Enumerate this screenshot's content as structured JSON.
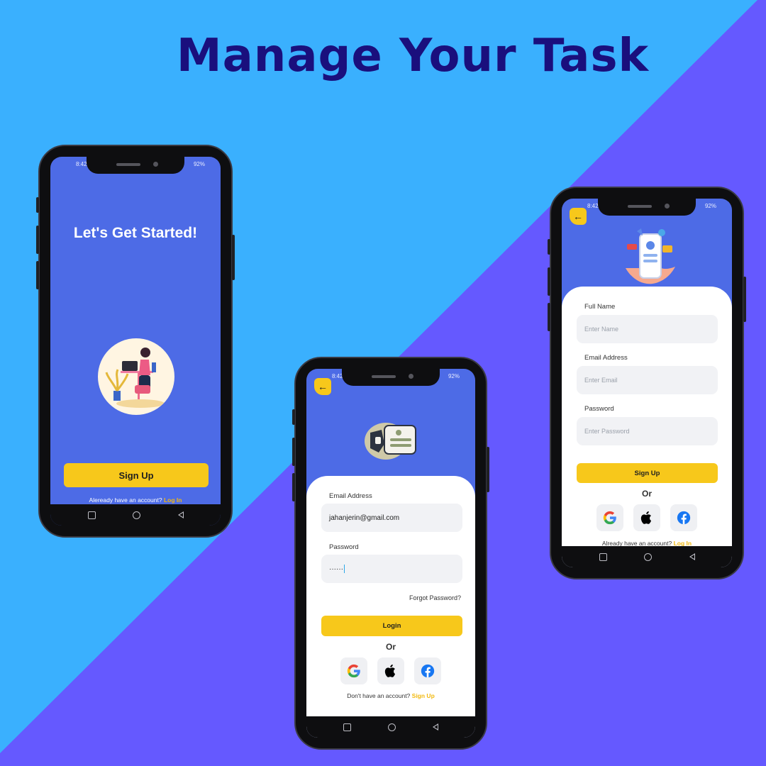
{
  "headline": "Manage Your Task",
  "colors": {
    "bg_light": "#3ab0fe",
    "bg_dark": "#6559ff",
    "headline": "#1a0f7d",
    "screen": "#4d6be6",
    "accent": "#f7c81b"
  },
  "status": {
    "time": "8:42",
    "battery": "92%"
  },
  "welcome": {
    "title": "Let's Get Started!",
    "signup_label": "Sign Up",
    "footer_text": "Aleready have an account?",
    "footer_link": "Log In"
  },
  "login": {
    "back_icon": "arrow-left-icon",
    "email_label": "Email Address",
    "email_value": "jahanjerin@gmail.com",
    "password_label": "Password",
    "password_value": "······",
    "forgot": "Forgot Password?",
    "login_label": "Login",
    "or": "Or",
    "footer_text": "Don't have an account?",
    "footer_link": "Sign Up"
  },
  "signup": {
    "back_icon": "arrow-left-icon",
    "name_label": "Full Name",
    "name_placeholder": "Enter Name",
    "email_label": "Email Address",
    "email_placeholder": "Enter Email",
    "password_label": "Password",
    "password_placeholder": "Enter Password",
    "signup_label": "Sign Up",
    "or": "Or",
    "footer_text": "Already have an account?",
    "footer_link": "Log In"
  },
  "social_icons": [
    "google-icon",
    "apple-icon",
    "facebook-icon"
  ]
}
